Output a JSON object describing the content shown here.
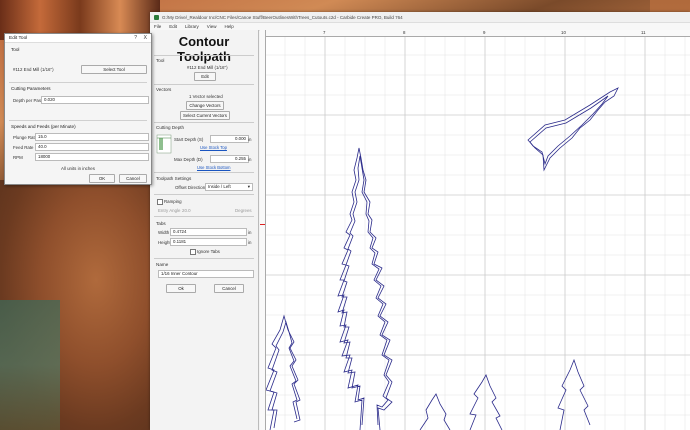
{
  "window": {
    "title": "G:/My Drive/_Realdoor Inc/CNC Files/Canoe Stuff/BeerOutlinesWithTrees_Cutouts.c2d - Carbide Create PRO, Build 764",
    "menu": [
      "File",
      "Edit",
      "Library",
      "View",
      "Help"
    ]
  },
  "panel": {
    "title": "Contour Toolpath",
    "tool": {
      "header": "Tool",
      "name": "#112 End Mill (1/16\")",
      "edit": "Edit"
    },
    "vectors": {
      "header": "Vectors",
      "selected": "1 Vector selected",
      "change": "Change Vectors",
      "select_current": "Select Current Vectors"
    },
    "cutting_depth": {
      "header": "Cutting Depth",
      "start_label": "Start Depth (S)",
      "start_value": "0.000",
      "unit": "in",
      "use_stock_top": "Use Stock Top",
      "max_label": "Max Depth (D)",
      "max_value": "0.255",
      "unit2": "in",
      "use_stock_bottom": "Use Stock Bottom"
    },
    "toolpath_settings": {
      "header": "Toolpath Settings",
      "offset_label": "Offset Direction",
      "offset_value": "Inside / Left"
    },
    "ramping": {
      "label": "Ramping",
      "entry_label": "Entry Angle",
      "entry_value": "20.0",
      "entry_unit": "Degrees"
    },
    "tabs": {
      "header": "Tabs",
      "width_label": "Width",
      "width_value": "0.4724",
      "height_label": "Height",
      "height_value": "0.1181",
      "unit": "in",
      "ignore": "Ignore Tabs"
    },
    "name": {
      "header": "Name",
      "value": "1/16 Inner Contour"
    },
    "ok": "Ok",
    "cancel": "Cancel"
  },
  "ruler": {
    "top": [
      "7",
      "8",
      "9",
      "10",
      "11"
    ]
  },
  "dialog": {
    "title": "Edit Tool",
    "help": "?",
    "close": "X",
    "tool_header": "Tool",
    "tool_name": "#112 End Mill (1/16\")",
    "select_tool": "Select Tool",
    "cutting_header": "Cutting Parameters",
    "depth_label": "Depth per Pass",
    "depth_value": "0.020",
    "speeds_header": "Speeds and Feeds (per Minute)",
    "plunge_label": "Plunge Rate",
    "plunge_value": "15.0",
    "feed_label": "Feed Rate",
    "feed_value": "40.0",
    "rpm_label": "RPM",
    "rpm_value": "18000",
    "units_note": "All units in inches",
    "ok": "OK",
    "cancel": "Cancel"
  },
  "colors": {
    "accent_link": "#1a55c0",
    "vector_line": "#2a2a8a"
  }
}
